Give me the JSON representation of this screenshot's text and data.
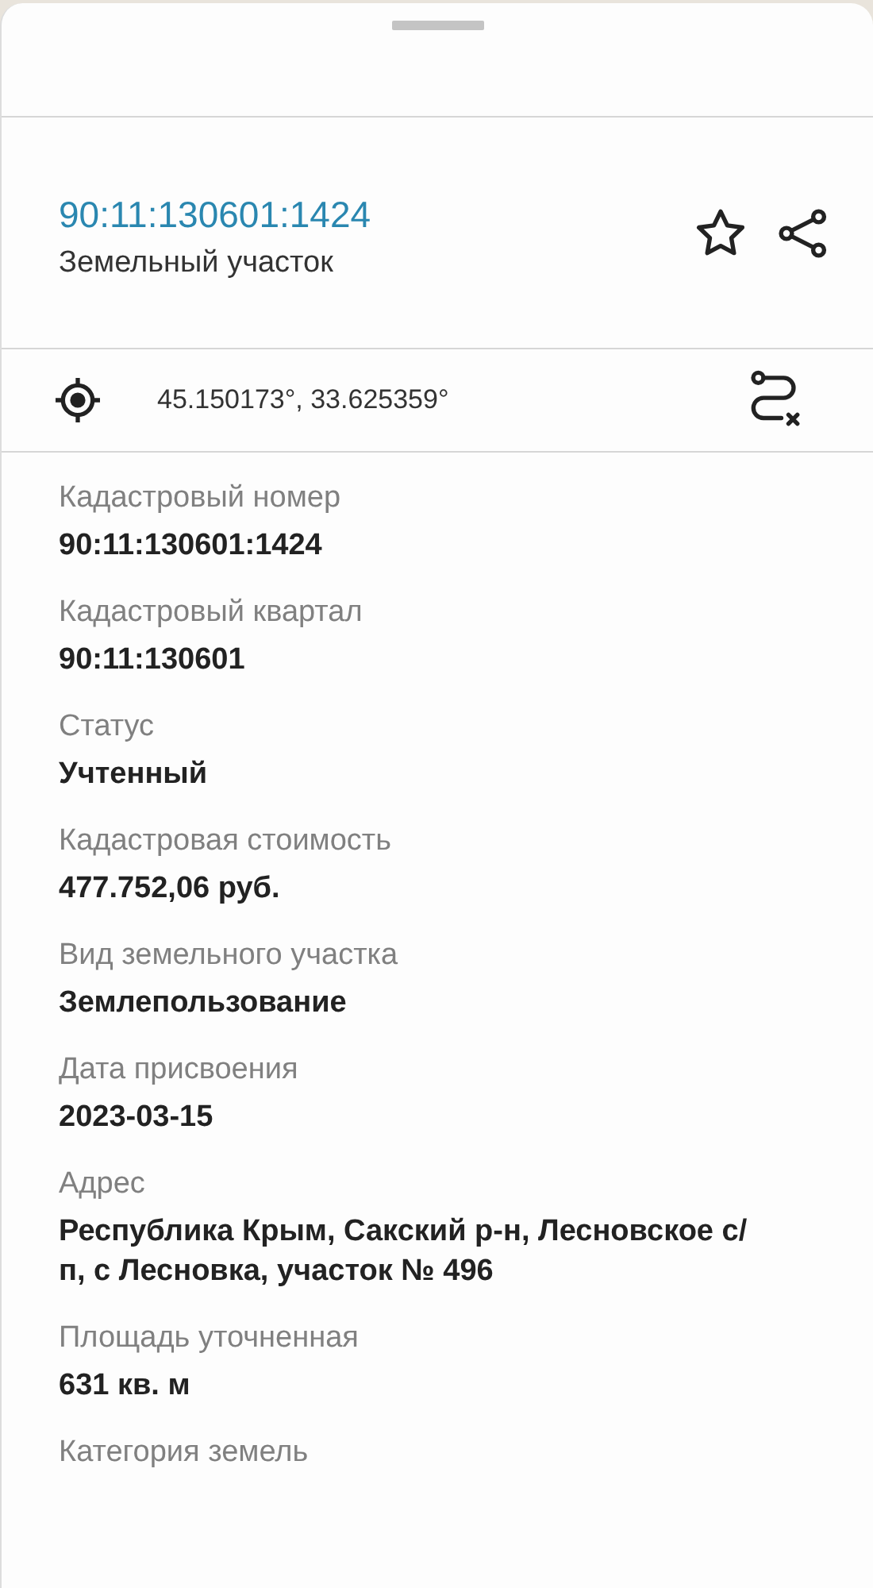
{
  "header": {
    "title": "90:11:130601:1424",
    "subtitle": "Земельный участок"
  },
  "coordinates": {
    "text": "45.150173°, 33.625359°"
  },
  "fields": [
    {
      "label": "Кадастровый номер",
      "value": "90:11:130601:1424"
    },
    {
      "label": "Кадастровый квартал",
      "value": "90:11:130601"
    },
    {
      "label": "Статус",
      "value": "Учтенный"
    },
    {
      "label": "Кадастровая стоимость",
      "value": "477.752,06 руб."
    },
    {
      "label": "Вид земельного участка",
      "value": "Землепользование"
    },
    {
      "label": "Дата присвоения",
      "value": "2023-03-15"
    },
    {
      "label": "Адрес",
      "value": "Республика Крым, Сакский р-н, Лесновское с/п, с Лесновка, участок № 496"
    },
    {
      "label": "Площадь уточненная",
      "value": "631 кв. м"
    },
    {
      "label": "Категория земель"
    }
  ]
}
